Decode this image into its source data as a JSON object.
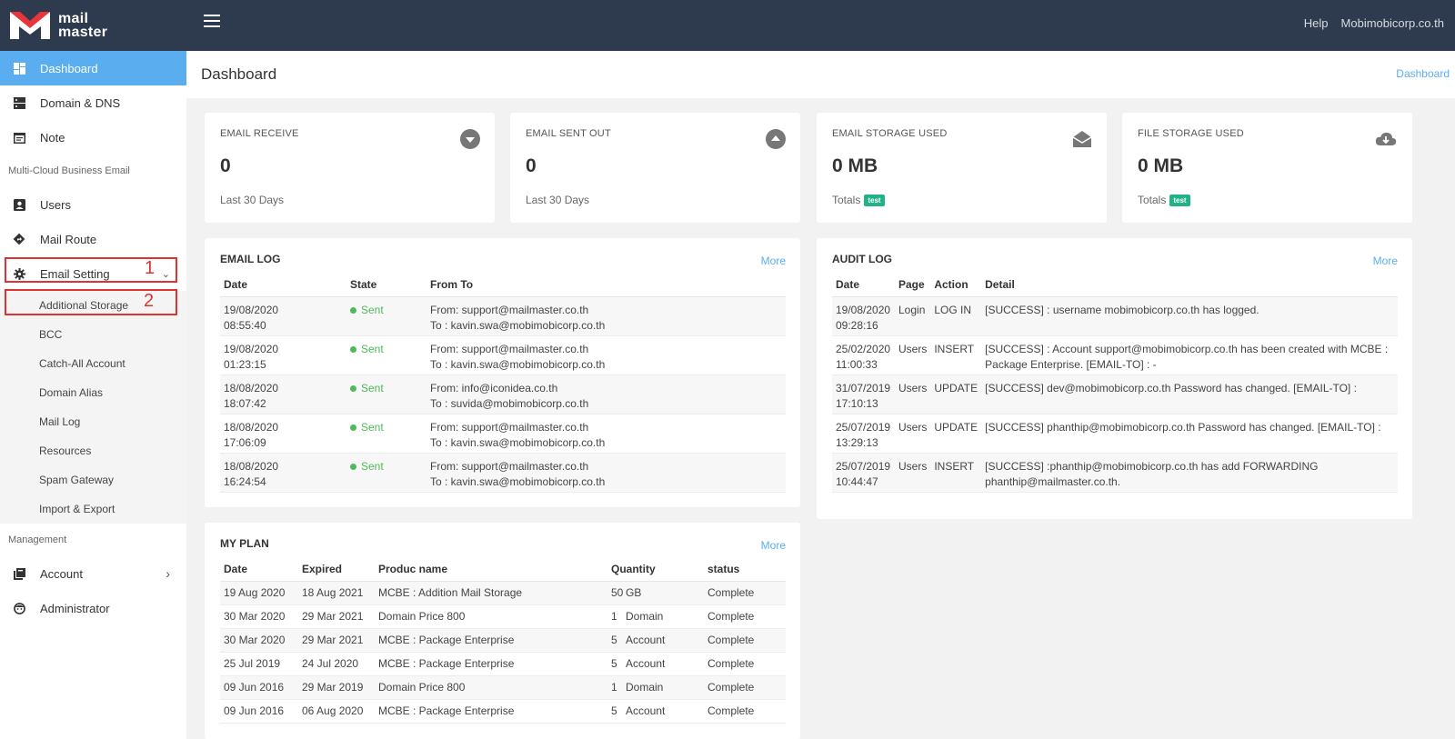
{
  "app": {
    "logo_top": "mail",
    "logo_bottom": "master"
  },
  "topbar": {
    "help": "Help",
    "account": "Mobimobicorp.co.th"
  },
  "sidebar": {
    "items_top": [
      {
        "label": "Dashboard",
        "icon": "dashboard-icon"
      },
      {
        "label": "Domain & DNS",
        "icon": "server-icon"
      },
      {
        "label": "Note",
        "icon": "note-icon"
      }
    ],
    "section_1": "Multi-Cloud Business Email",
    "items_mid": [
      {
        "label": "Users",
        "icon": "user-card-icon"
      },
      {
        "label": "Mail Route",
        "icon": "route-icon"
      },
      {
        "label": "Email Setting",
        "icon": "gear-icon"
      }
    ],
    "sub_items": [
      "Additional Storage",
      "BCC",
      "Catch-All Account",
      "Domain Alias",
      "Mail Log",
      "Resources",
      "Spam Gateway",
      "Import & Export"
    ],
    "section_2": "Management",
    "items_bottom": [
      {
        "label": "Account",
        "icon": "book-icon"
      },
      {
        "label": "Administrator",
        "icon": "admin-face-icon"
      }
    ],
    "annotation_1": "1",
    "annotation_2": "2"
  },
  "header": {
    "title": "Dashboard",
    "breadcrumb": "Dashboard"
  },
  "stats": [
    {
      "label": "EMAIL RECEIVE",
      "value": "0",
      "foot": "Last 30 Days",
      "icon": "arrow-down-circle-icon"
    },
    {
      "label": "EMAIL SENT OUT",
      "value": "0",
      "foot": "Last 30 Days",
      "icon": "arrow-up-circle-icon"
    },
    {
      "label": "EMAIL STORAGE USED",
      "value": "0 MB",
      "foot": "Totals",
      "badge": "test",
      "icon": "envelope-open-icon"
    },
    {
      "label": "FILE STORAGE USED",
      "value": "0 MB",
      "foot": "Totals",
      "badge": "test",
      "icon": "cloud-download-icon"
    }
  ],
  "email_log": {
    "title": "EMAIL LOG",
    "more": "More",
    "headers": [
      "Date",
      "State",
      "From To"
    ],
    "rows": [
      {
        "date": "19/08/2020",
        "time": "08:55:40",
        "state": "Sent",
        "from": "From: support@mailmaster.co.th",
        "to": "To : kavin.swa@mobimobicorp.co.th"
      },
      {
        "date": "19/08/2020",
        "time": "01:23:15",
        "state": "Sent",
        "from": "From: support@mailmaster.co.th",
        "to": "To : kavin.swa@mobimobicorp.co.th"
      },
      {
        "date": "18/08/2020",
        "time": "18:07:42",
        "state": "Sent",
        "from": "From: info@iconidea.co.th",
        "to": "To : suvida@mobimobicorp.co.th"
      },
      {
        "date": "18/08/2020",
        "time": "17:06:09",
        "state": "Sent",
        "from": "From: support@mailmaster.co.th",
        "to": "To : kavin.swa@mobimobicorp.co.th"
      },
      {
        "date": "18/08/2020",
        "time": "16:24:54",
        "state": "Sent",
        "from": "From: support@mailmaster.co.th",
        "to": "To : kavin.swa@mobimobicorp.co.th"
      }
    ]
  },
  "audit_log": {
    "title": "AUDIT LOG",
    "more": "More",
    "headers": [
      "Date",
      "Page",
      "Action",
      "Detail"
    ],
    "rows": [
      {
        "date": "19/08/2020",
        "time": "09:28:16",
        "page": "Login",
        "action": "LOG IN",
        "detail1": "[SUCCESS] : username mobimobicorp.co.th has logged.",
        "detail2": ""
      },
      {
        "date": "25/02/2020",
        "time": "11:00:33",
        "page": "Users",
        "action": "INSERT",
        "detail1": "[SUCCESS] : Account support@mobimobicorp.co.th has been created with MCBE :",
        "detail2": "Package Enterprise. [EMAIL-TO] : -"
      },
      {
        "date": "31/07/2019",
        "time": "17:10:13",
        "page": "Users",
        "action": "UPDATE",
        "detail1": "[SUCCESS] dev@mobimobicorp.co.th Password has changed. [EMAIL-TO] :",
        "detail2": ""
      },
      {
        "date": "25/07/2019",
        "time": "13:29:13",
        "page": "Users",
        "action": "UPDATE",
        "detail1": "[SUCCESS] phanthip@mobimobicorp.co.th Password has changed. [EMAIL-TO] :",
        "detail2": ""
      },
      {
        "date": "25/07/2019",
        "time": "10:44:47",
        "page": "Users",
        "action": "INSERT",
        "detail1": "[SUCCESS] :phanthip@mobimobicorp.co.th has add FORWARDING",
        "detail2": "phanthip@mailmaster.co.th."
      }
    ]
  },
  "my_plan": {
    "title": "MY PLAN",
    "more": "More",
    "headers": [
      "Date",
      "Expired",
      "Produc name",
      "Quantity",
      "status"
    ],
    "rows": [
      {
        "date": "19 Aug 2020",
        "expired": "18 Aug 2021",
        "product": "MCBE : Addition Mail Storage",
        "qty": "50",
        "unit": "GB",
        "status": "Complete"
      },
      {
        "date": "30 Mar 2020",
        "expired": "29 Mar 2021",
        "product": "Domain Price 800",
        "qty": "1",
        "unit": "Domain",
        "status": "Complete"
      },
      {
        "date": "30 Mar 2020",
        "expired": "29 Mar 2021",
        "product": "MCBE : Package Enterprise",
        "qty": "5",
        "unit": "Account",
        "status": "Complete"
      },
      {
        "date": "25 Jul 2019",
        "expired": "24 Jul 2020",
        "product": "MCBE : Package Enterprise",
        "qty": "5",
        "unit": "Account",
        "status": "Complete"
      },
      {
        "date": "09 Jun 2016",
        "expired": "29 Mar 2019",
        "product": "Domain Price 800",
        "qty": "1",
        "unit": "Domain",
        "status": "Complete"
      },
      {
        "date": "09 Jun 2016",
        "expired": "06 Aug 2020",
        "product": "MCBE : Package Enterprise",
        "qty": "5",
        "unit": "Account",
        "status": "Complete"
      }
    ]
  }
}
